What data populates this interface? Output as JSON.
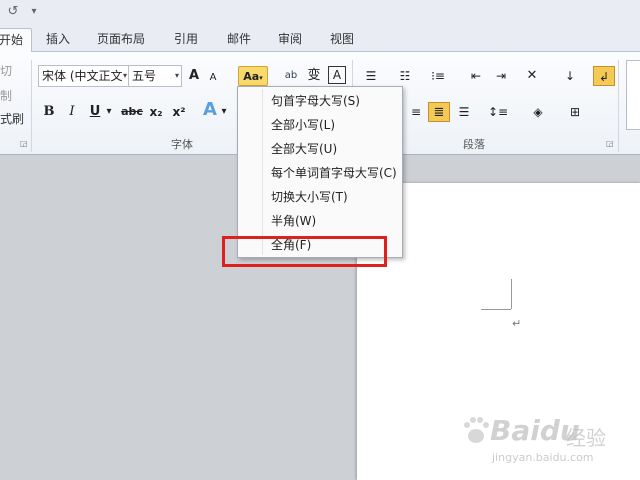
{
  "quick_access": {
    "undo_glyph": "↺",
    "customize_glyph": "▾"
  },
  "tabs": [
    {
      "label": "开始",
      "active": true
    },
    {
      "label": "插入"
    },
    {
      "label": "页面布局"
    },
    {
      "label": "引用"
    },
    {
      "label": "邮件"
    },
    {
      "label": "审阅"
    },
    {
      "label": "视图"
    }
  ],
  "clipboard": {
    "cut": "切",
    "copy": "制",
    "format_painter": "式刷"
  },
  "font_group": {
    "label": "字体",
    "font_name": "宋体 (中文正文",
    "font_size": "五号",
    "grow_font": "A",
    "shrink_font": "A",
    "change_case": "Aa",
    "bold": "B",
    "italic": "I",
    "underline": "U",
    "strikethrough": "abc",
    "subscript": "x₂",
    "superscript": "x²",
    "text_effect": "A"
  },
  "paragraph_group": {
    "label": "段落"
  },
  "change_case_menu": {
    "items": [
      "句首字母大写(S)",
      "全部小写(L)",
      "全部大写(U)",
      "每个单词首字母大写(C)",
      "切换大小写(T)",
      "半角(W)",
      "全角(F)"
    ],
    "highlighted_item": "全角(F)"
  },
  "document": {
    "paragraph_mark": "↵"
  },
  "watermark": {
    "brand": "Baidu",
    "brand_suffix": "经验",
    "url": "jingyan.baidu.com"
  },
  "colors": {
    "highlight": "#e0201e",
    "active_button": "#f8d96b"
  }
}
